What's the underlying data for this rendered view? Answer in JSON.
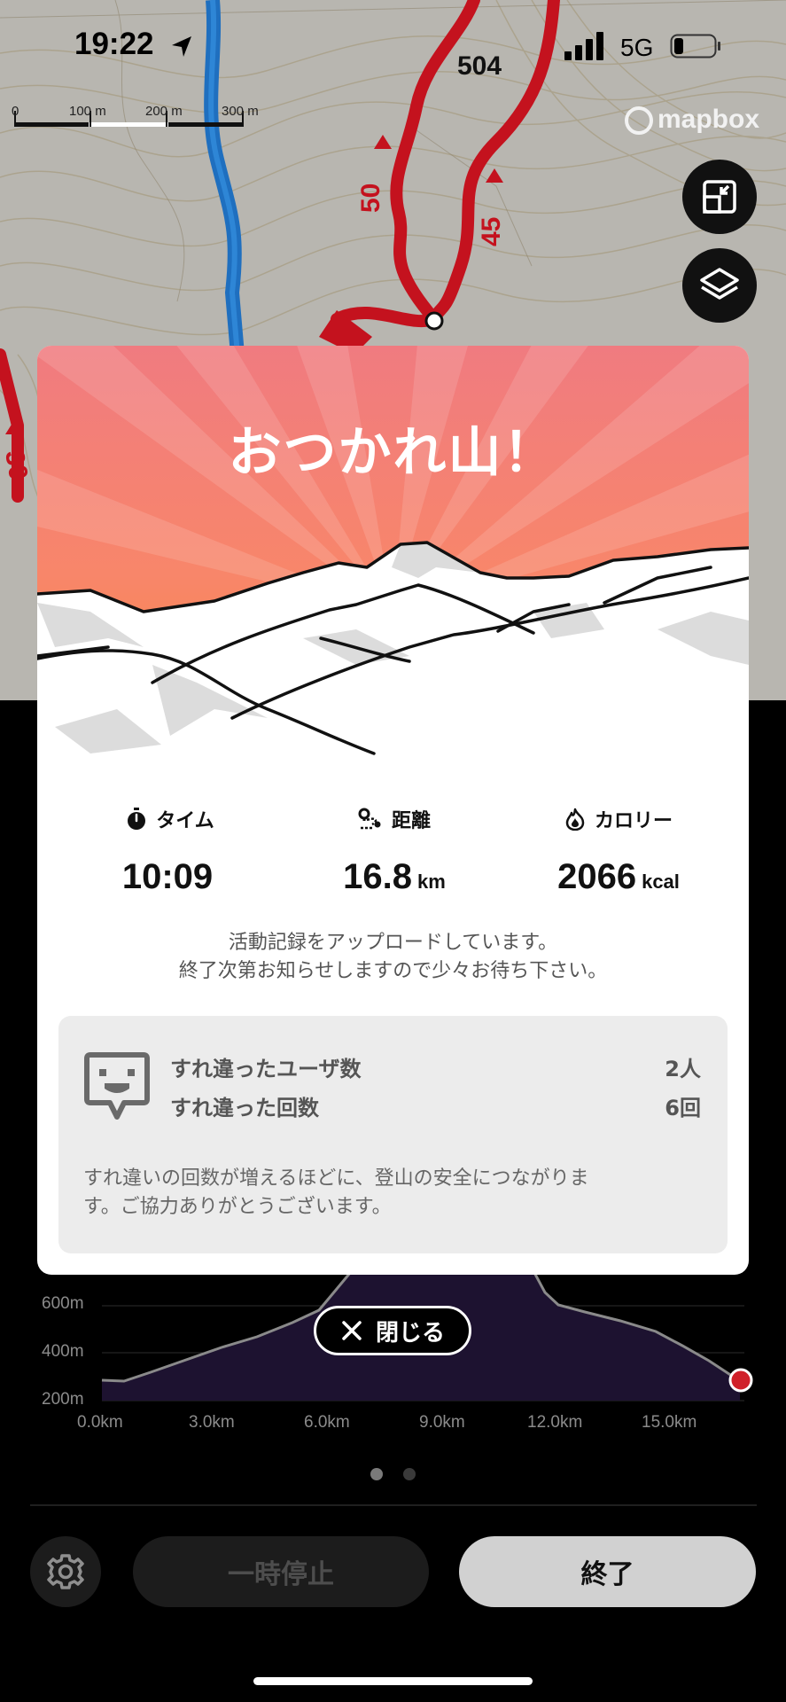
{
  "status_bar": {
    "time": "19:22",
    "carrier": "5G"
  },
  "map": {
    "scale_labels": [
      "0",
      "100 m",
      "200 m",
      "300 m"
    ],
    "route_labels": [
      "504",
      "50",
      "45",
      "30"
    ],
    "attribution": "mapbox",
    "buttons": [
      {
        "icon": "expand-map-icon"
      },
      {
        "icon": "layers-icon"
      }
    ]
  },
  "modal": {
    "title": "おつかれ山！",
    "stats": [
      {
        "icon": "stopwatch-icon",
        "label": "タイム",
        "value": "10:09",
        "unit": ""
      },
      {
        "icon": "route-icon",
        "label": "距離",
        "value": "16.8",
        "unit": "km"
      },
      {
        "icon": "flame-icon",
        "label": "カロリー",
        "value": "2066",
        "unit": "kcal"
      }
    ],
    "upload_message_line1": "活動記録をアップロードしています。",
    "upload_message_line2": "終了次第お知らせしますので少々お待ち下さい。",
    "encounter": {
      "icon": "encounter-face-icon",
      "users_label": "すれ違ったユーザ数",
      "users_value": "2人",
      "count_label": "すれ違った回数",
      "count_value": "6回",
      "note_line1": "すれ違いの回数が増えるほどに、登山の安全につながりま",
      "note_line2": "す。ご協力ありがとうございます。"
    }
  },
  "elevation_chart": {
    "y_ticks": [
      "600m",
      "400m",
      "200m"
    ],
    "x_ticks": [
      "0.0km",
      "3.0km",
      "6.0km",
      "9.0km",
      "12.0km",
      "15.0km"
    ]
  },
  "close_button": {
    "label": "閉じる"
  },
  "page_dots": {
    "count": 2,
    "active": 0
  },
  "bottom_bar": {
    "settings_icon": "gear-icon",
    "pause_label": "一時停止",
    "end_label": "終了"
  },
  "colors": {
    "header_top": "#f07b80",
    "header_bottom": "#f88a3a",
    "route": "#c4121e",
    "river": "#1f6fbf",
    "end_marker": "#d0202a"
  }
}
